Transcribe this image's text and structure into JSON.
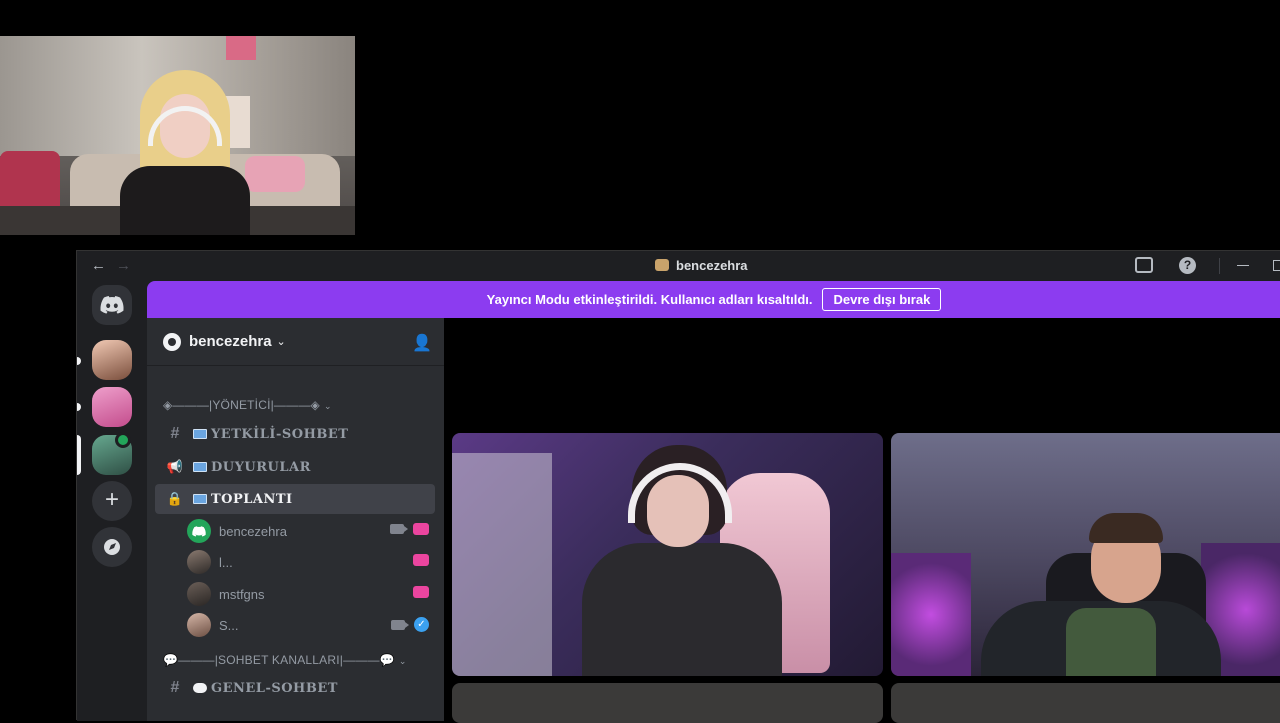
{
  "window": {
    "title": "bencezehra",
    "nav_back": "←",
    "nav_forward": "→",
    "help": "?"
  },
  "banner": {
    "text": "Yayıncı Modu etkinleştirildi. Kullanıcı adları kısaltıldı.",
    "button": "Devre dışı bırak"
  },
  "server": {
    "name": "bencezehra"
  },
  "rail": {
    "add": "+"
  },
  "categories": [
    {
      "label": "◈———|YÖNETİCİ|———◈"
    },
    {
      "label": "💬———|SOHBET KANALLARI|———💬"
    }
  ],
  "channels": [
    {
      "icon": "#",
      "name": "YETKİLİ-SOHBET"
    },
    {
      "icon": "📢",
      "name": "DUYURULAR"
    },
    {
      "icon": "🔒",
      "name": "TOPLANTI"
    },
    {
      "icon": "#",
      "name": "GENEL-SOHBET"
    }
  ],
  "voice_users": [
    {
      "name": "bencezehra",
      "camera": true,
      "live": true
    },
    {
      "name": "l...",
      "camera": false,
      "live": true
    },
    {
      "name": "mstfgns",
      "camera": false,
      "live": true
    },
    {
      "name": "S...",
      "camera": true,
      "verified": true
    }
  ],
  "colors": {
    "banner": "#8c3cf0",
    "live": "#eb459f",
    "online": "#23a55a"
  }
}
